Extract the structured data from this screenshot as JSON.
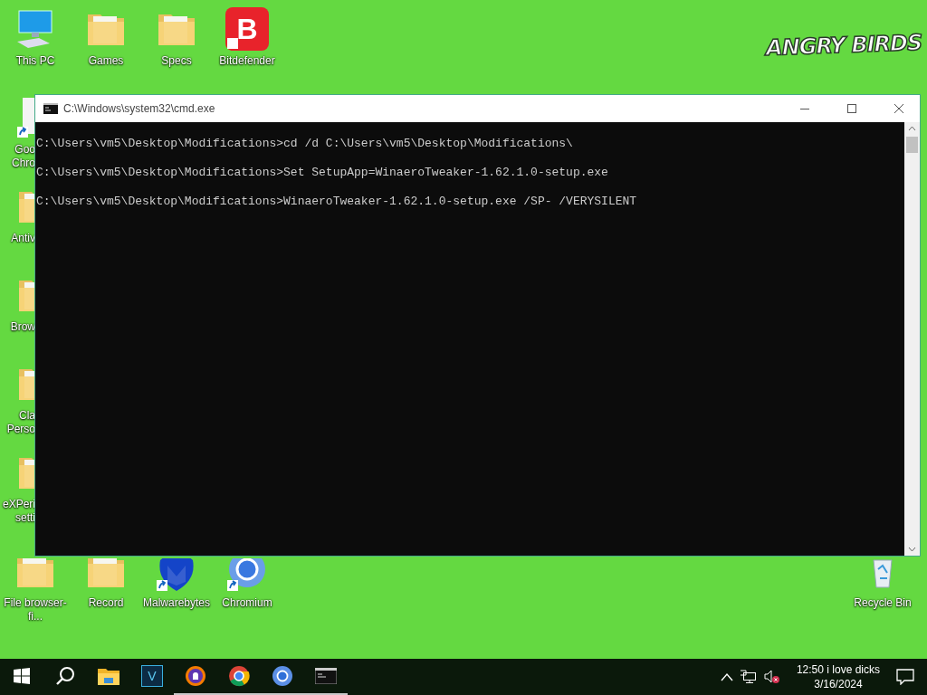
{
  "wallpaper": {
    "logo": "ANGRY BIRDS"
  },
  "desktop": {
    "top_row": [
      {
        "label": "This PC",
        "kind": "pc",
        "shortcut": false
      },
      {
        "label": "Games",
        "kind": "folder",
        "shortcut": false
      },
      {
        "label": "Specs",
        "kind": "folder",
        "shortcut": false
      },
      {
        "label": "Bitdefender",
        "kind": "bitdefender",
        "glyph": "B",
        "shortcut": true
      }
    ],
    "left_column": [
      {
        "label": "Goo Chro",
        "kind": "document",
        "shortcut": true
      },
      {
        "label": "Antiv",
        "kind": "folder",
        "shortcut": false
      },
      {
        "label": "Brow",
        "kind": "folder",
        "shortcut": false
      },
      {
        "label": "Cla Perso",
        "kind": "folder",
        "shortcut": false
      },
      {
        "label": "eXPeri setti",
        "kind": "folder",
        "shortcut": false
      }
    ],
    "bottom_row": [
      {
        "label": "File browser-fi...",
        "kind": "folder",
        "shortcut": false
      },
      {
        "label": "Record",
        "kind": "folder",
        "shortcut": false
      },
      {
        "label": "Malwarebytes",
        "kind": "malwarebytes",
        "shortcut": true
      },
      {
        "label": "Chromium",
        "kind": "chromium",
        "shortcut": true
      }
    ],
    "right_column": [
      {
        "label": "Recycle Bin",
        "kind": "recycle",
        "shortcut": false
      }
    ]
  },
  "window": {
    "title": "C:\\Windows\\system32\\cmd.exe",
    "lines": [
      "C:\\Users\\vm5\\Desktop\\Modifications>cd /d C:\\Users\\vm5\\Desktop\\Modifications\\",
      "C:\\Users\\vm5\\Desktop\\Modifications>Set SetupApp=WinaeroTweaker-1.62.1.0-setup.exe",
      "C:\\Users\\vm5\\Desktop\\Modifications>WinaeroTweaker-1.62.1.0-setup.exe /SP- /VERYSILENT"
    ]
  },
  "taskbar": {
    "apps": [
      {
        "kind": "start",
        "running": false
      },
      {
        "kind": "search",
        "running": false
      },
      {
        "kind": "explorer",
        "running": false
      },
      {
        "kind": "letter",
        "glyph": "V",
        "running": false
      },
      {
        "kind": "shield",
        "running": true
      },
      {
        "kind": "chrome",
        "running": true
      },
      {
        "kind": "chromium",
        "running": true
      },
      {
        "kind": "cmd",
        "running": true
      }
    ],
    "clock": {
      "time": "12:50 i love dicks",
      "date": "3/16/2024"
    }
  }
}
